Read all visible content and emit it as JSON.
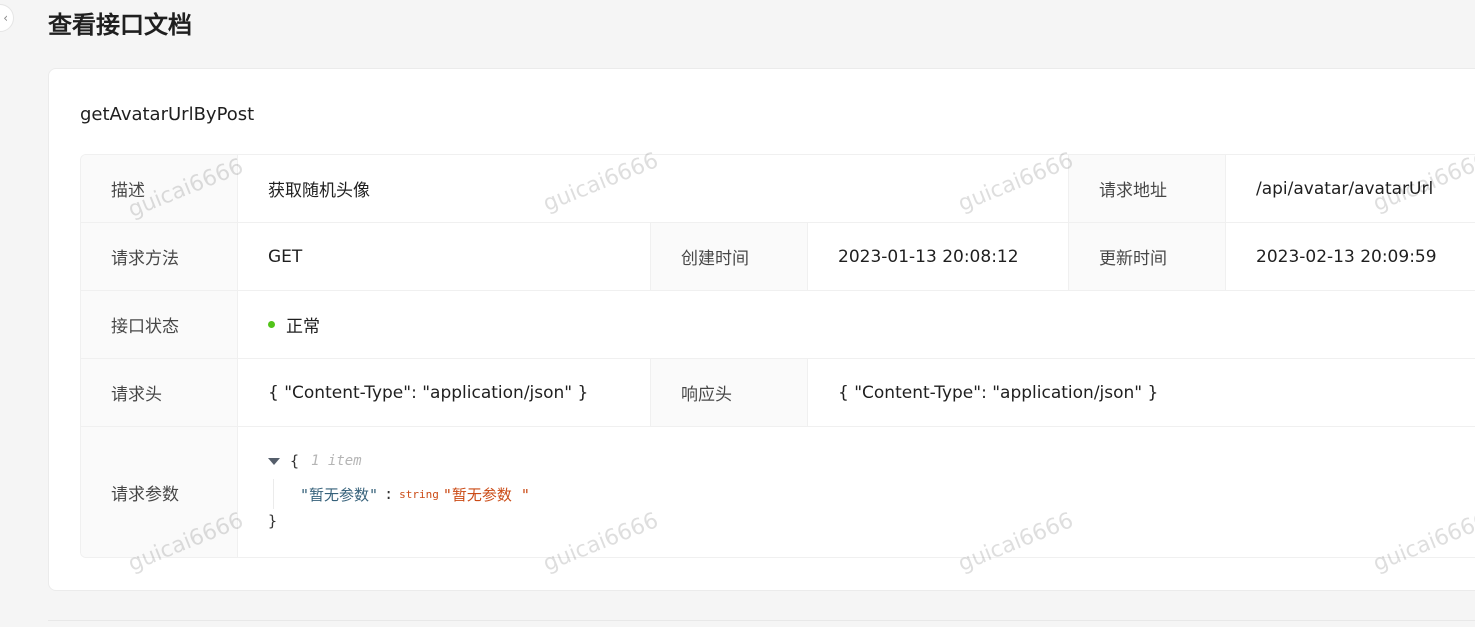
{
  "page": {
    "title": "查看接口文档"
  },
  "card": {
    "title": "getAvatarUrlByPost"
  },
  "details": {
    "description": {
      "label": "描述",
      "value": "获取随机头像"
    },
    "url": {
      "label": "请求地址",
      "value": "/api/avatar/avatarUrl"
    },
    "method": {
      "label": "请求方法",
      "value": "GET"
    },
    "created": {
      "label": "创建时间",
      "value": "2023-01-13 20:08:12"
    },
    "updated": {
      "label": "更新时间",
      "value": "2023-02-13 20:09:59"
    },
    "status": {
      "label": "接口状态",
      "value": "正常",
      "color": "#52c41a"
    },
    "request_header": {
      "label": "请求头",
      "value": "{ \"Content-Type\": \"application/json\" }"
    },
    "response_header": {
      "label": "响应头",
      "value": "{ \"Content-Type\": \"application/json\" }"
    },
    "request_params": {
      "label": "请求参数",
      "open_brace": "{",
      "item_count": "1 item",
      "key": "\"暂无参数\"",
      "colon": ":",
      "type": "string",
      "value": "\"暂无参数 \"",
      "close_brace": "}"
    }
  },
  "watermark": {
    "text": "guicai6666"
  },
  "icons": {
    "collapse": "chevron-left-icon",
    "expand": "caret-down-icon"
  }
}
